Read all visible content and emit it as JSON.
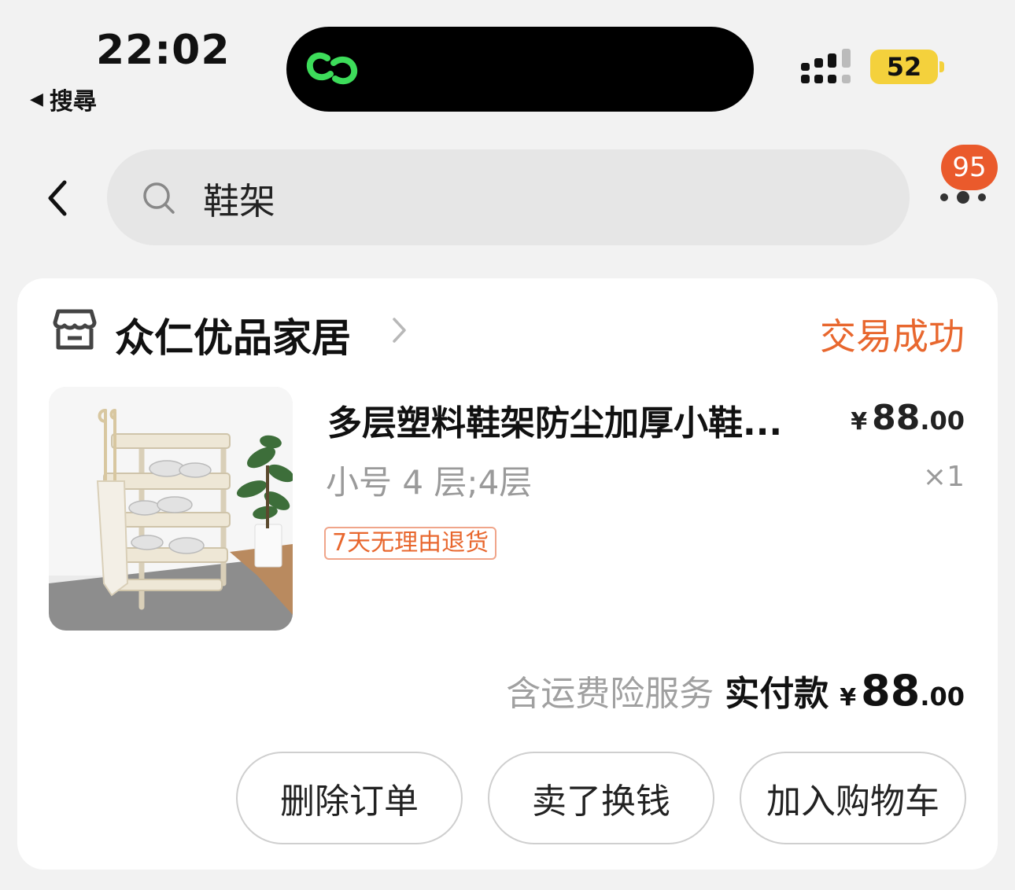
{
  "status_bar": {
    "time": "22:02",
    "back_app": "搜尋",
    "back_icon": "back-triangle-icon",
    "battery": "52",
    "battery_color": "#f4d13c"
  },
  "search": {
    "query": "鞋架",
    "notification_count": "95",
    "badge_color": "#ea5a2c"
  },
  "order": {
    "shop_name": "众仁优品家居",
    "status": "交易成功",
    "status_color": "#e8672e",
    "product": {
      "title": "多层塑料鞋架防尘加厚小鞋...",
      "price_symbol": "¥",
      "price_int": "88",
      "price_dec": ".00",
      "sku": "小号 4 层;4层",
      "quantity": "×1",
      "tag": "7天无理由退货"
    },
    "insurance": "含运费险服务",
    "paid_label": "实付款",
    "total_symbol": "¥",
    "total_int": "88",
    "total_dec": ".00",
    "actions": {
      "delete": "删除订单",
      "resell": "卖了换钱",
      "add_cart": "加入购物车"
    }
  }
}
